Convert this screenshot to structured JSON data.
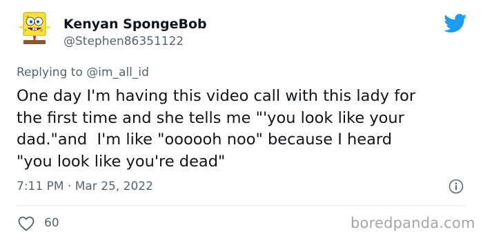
{
  "author": {
    "display_name": "Kenyan SpongeBob",
    "handle": "@Stephen86351122",
    "avatar_icon": "spongebob-avatar-icon"
  },
  "platform_icon": "twitter-bird-icon",
  "reply_context": {
    "prefix": "Replying to ",
    "mention": "@im_all_id"
  },
  "tweet": {
    "text_lines": [
      "One day I'm having this video call with this lady for",
      "the first time and she tells me \"'you look like your",
      "dad.\"and  I'm like \"oooooh noo\" because I heard",
      "\"you look like you're dead\""
    ],
    "timestamp": "7:11 PM · Mar 25, 2022"
  },
  "engagement": {
    "likes": "60"
  },
  "watermark": "boredpanda.com",
  "colors": {
    "twitter_blue": "#1d9bf0",
    "secondary_text": "#536471",
    "primary_text": "#0f1419",
    "avatar_yellow": "#f5e33b"
  }
}
